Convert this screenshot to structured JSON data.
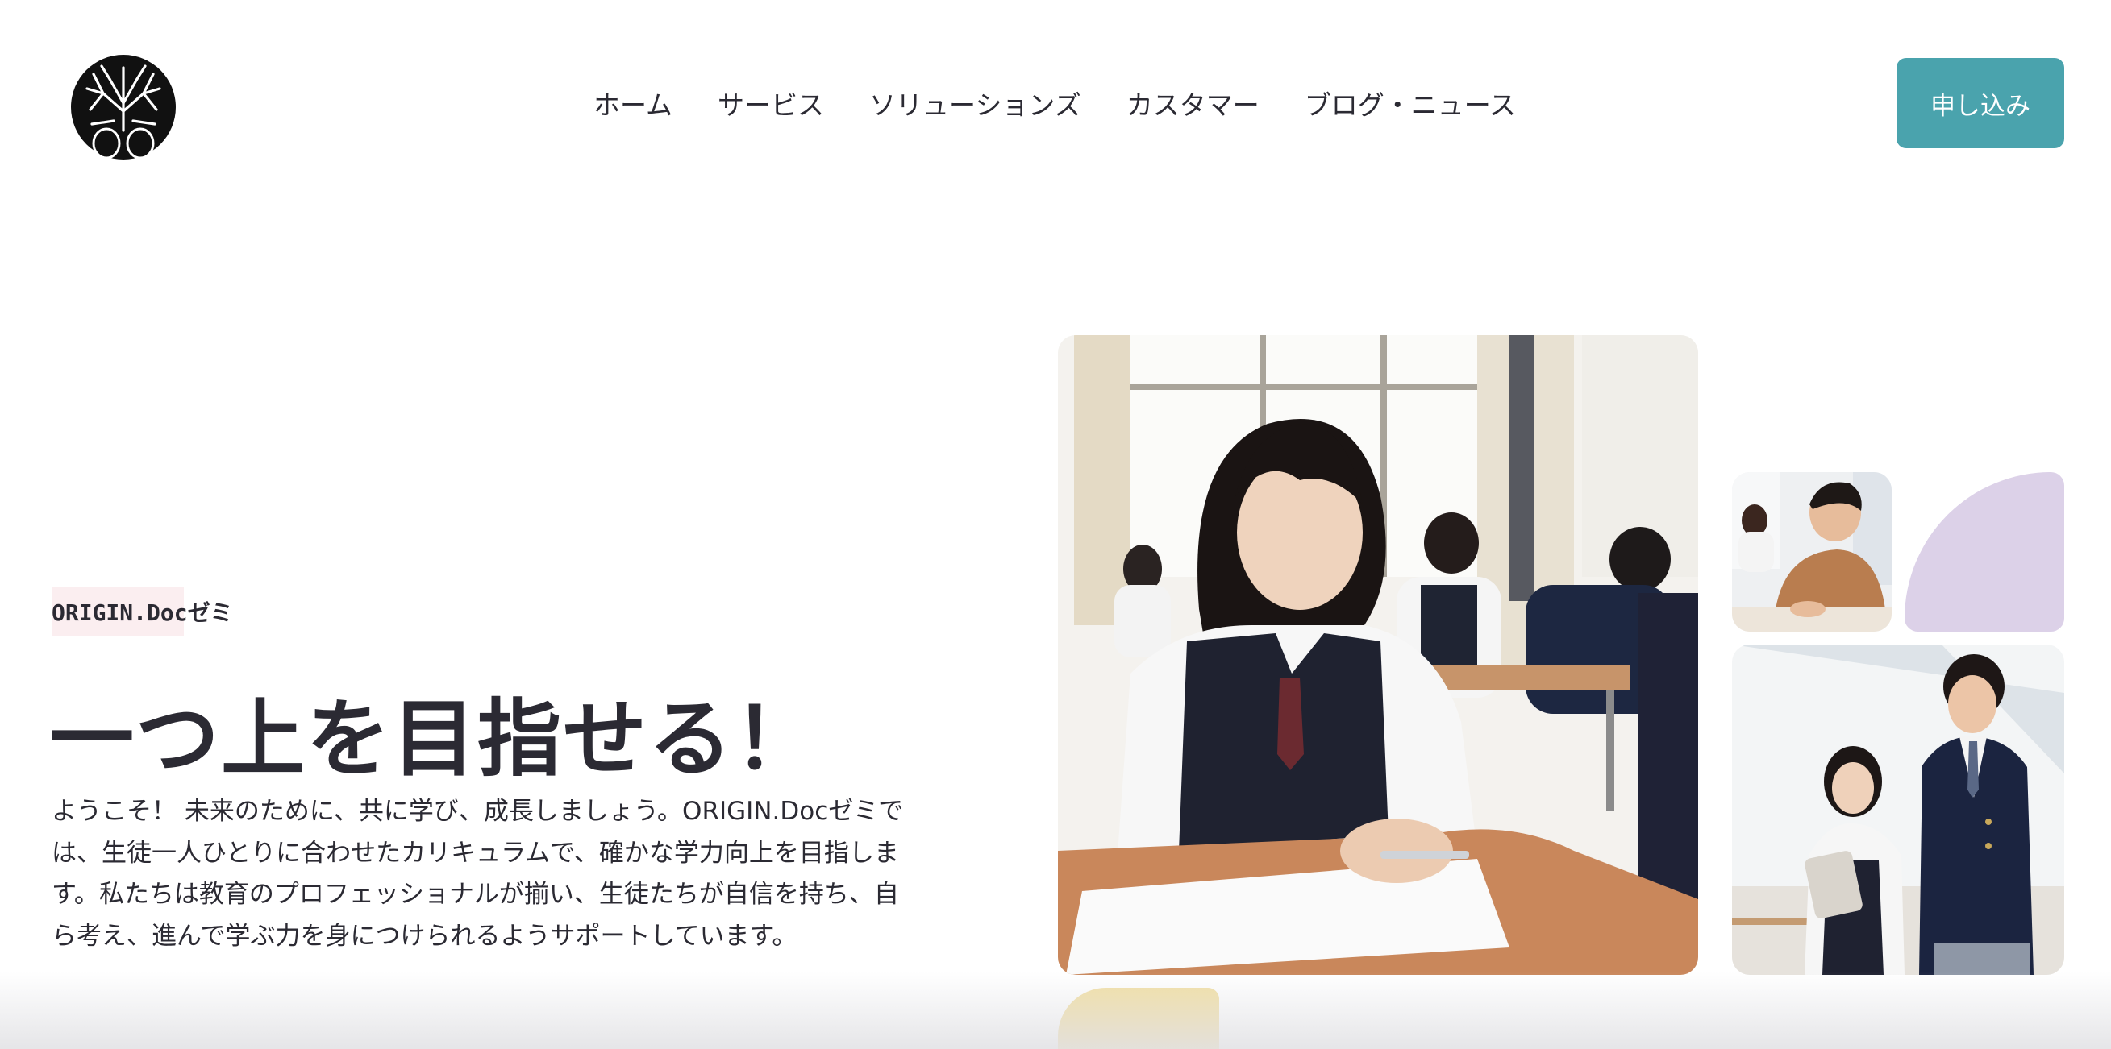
{
  "header": {
    "nav": [
      {
        "label": "ホーム"
      },
      {
        "label": "サービス"
      },
      {
        "label": "ソリューションズ"
      },
      {
        "label": "カスタマー"
      },
      {
        "label": "ブログ・ニュース"
      }
    ],
    "cta_label": "申し込み"
  },
  "hero": {
    "tag": "ORIGIN.Docゼミ",
    "headline": "一つ上を目指せる！",
    "description": "ようこそ！ 未来のために、共に学び、成長しましょう。ORIGIN.Docゼミでは、生徒一人ひとりに合わせたカリキュラムで、確かな学力向上を目指します。私たちは教育のプロフェッショナルが揃い、生徒たちが自信を持ち、自ら考え、進んで学ぶ力を身につけられるようサポートしています。"
  },
  "colors": {
    "accent": "#4aa3ad",
    "tag_background": "#fbeef0",
    "lavender": "#dcd1e8",
    "butter": "#f2dfa4",
    "text": "#2b2a33"
  },
  "icons": {
    "logo": "tree-logo-icon"
  }
}
